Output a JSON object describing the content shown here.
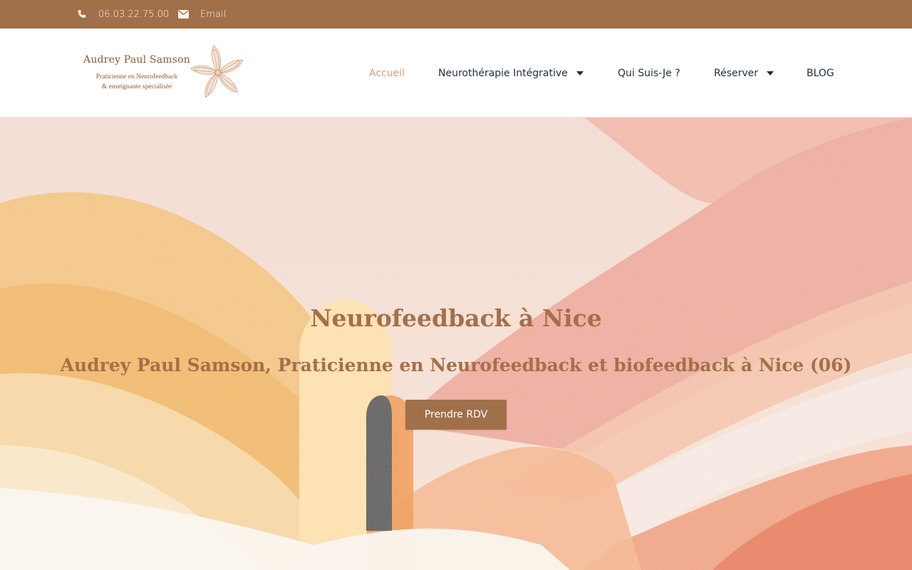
{
  "topbar": {
    "phone": "06.03.22.75.00",
    "phone_icon": "phone-icon",
    "email": "Email",
    "email_icon": "envelope-icon"
  },
  "logo": {
    "name": "Audrey Paul Samson",
    "line1": "Praticienne en Neurofeedback",
    "line2": "& enseignante spécialisée",
    "emblem_icon": "flower-icon"
  },
  "nav": {
    "items": [
      {
        "label": "Accueil",
        "active": true,
        "dropdown": false
      },
      {
        "label": "Neurothérapie Intégrative",
        "active": false,
        "dropdown": true
      },
      {
        "label": "Qui Suis-Je ?",
        "active": false,
        "dropdown": false
      },
      {
        "label": "Réserver",
        "active": false,
        "dropdown": true
      },
      {
        "label": "BLOG",
        "active": false,
        "dropdown": false
      }
    ]
  },
  "hero": {
    "title": "Neurofeedback à Nice",
    "subtitle": "Audrey Paul Samson, Praticienne en Neurofeedback et biofeedback à Nice (06)",
    "cta_label": "Prendre RDV"
  },
  "colors": {
    "brand": "#a0704a",
    "nav_active": "#c9a37f",
    "nav_text": "#1f2d3d",
    "heading": "#a4704a"
  }
}
